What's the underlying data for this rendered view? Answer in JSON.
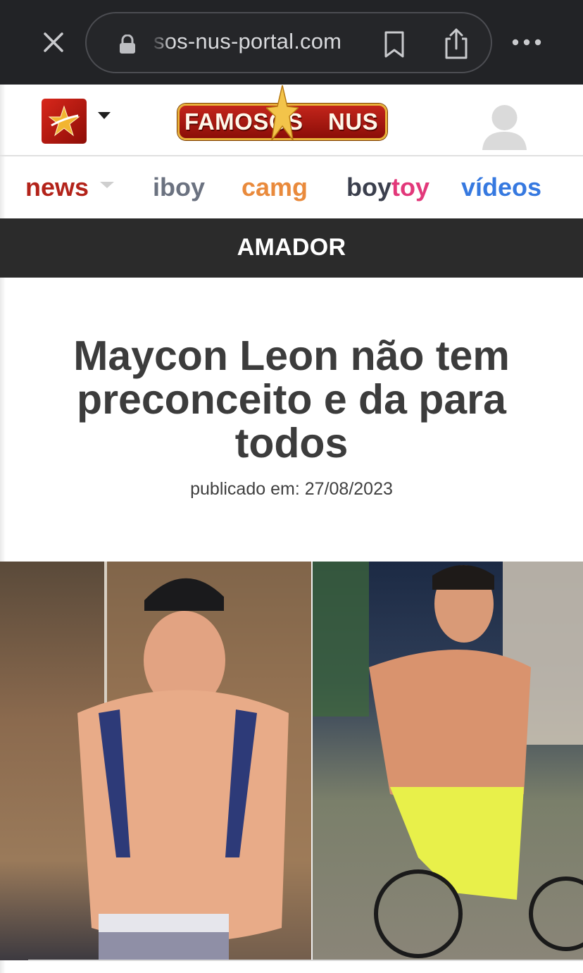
{
  "browser": {
    "url": "sos-nus-portal.com",
    "close_icon": "close-icon",
    "lock_icon": "lock-icon",
    "bookmark_icon": "bookmark-icon",
    "share_icon": "share-icon",
    "more_icon": "more-horizontal-icon"
  },
  "header": {
    "brand_left": "FAMOSOS",
    "brand_right": "NUS",
    "logo_icon": "star-logo-icon",
    "avatar_icon": "user-avatar-icon"
  },
  "nav": {
    "items": [
      {
        "label": "news",
        "color": "#b3231a"
      },
      {
        "label": "iboy",
        "color": "#6b7280"
      },
      {
        "label": "camg",
        "color": "#e98a3c"
      },
      {
        "label_part1": "boy",
        "label_part2": "toy",
        "color1": "#3b3f4d",
        "color2": "#e2387a"
      },
      {
        "label": "vídeos",
        "color": "#3679e0"
      }
    ]
  },
  "category": {
    "label": "AMADOR"
  },
  "article": {
    "title": "Maycon Leon não tem preconceito e da para todos",
    "date_label": "publicado em:",
    "date_value": "27/08/2023"
  },
  "colors": {
    "chrome_bg": "#222326",
    "category_bg": "#2b2b2b",
    "title_text": "#3c3c3c",
    "brand_red": "#b3231a"
  }
}
